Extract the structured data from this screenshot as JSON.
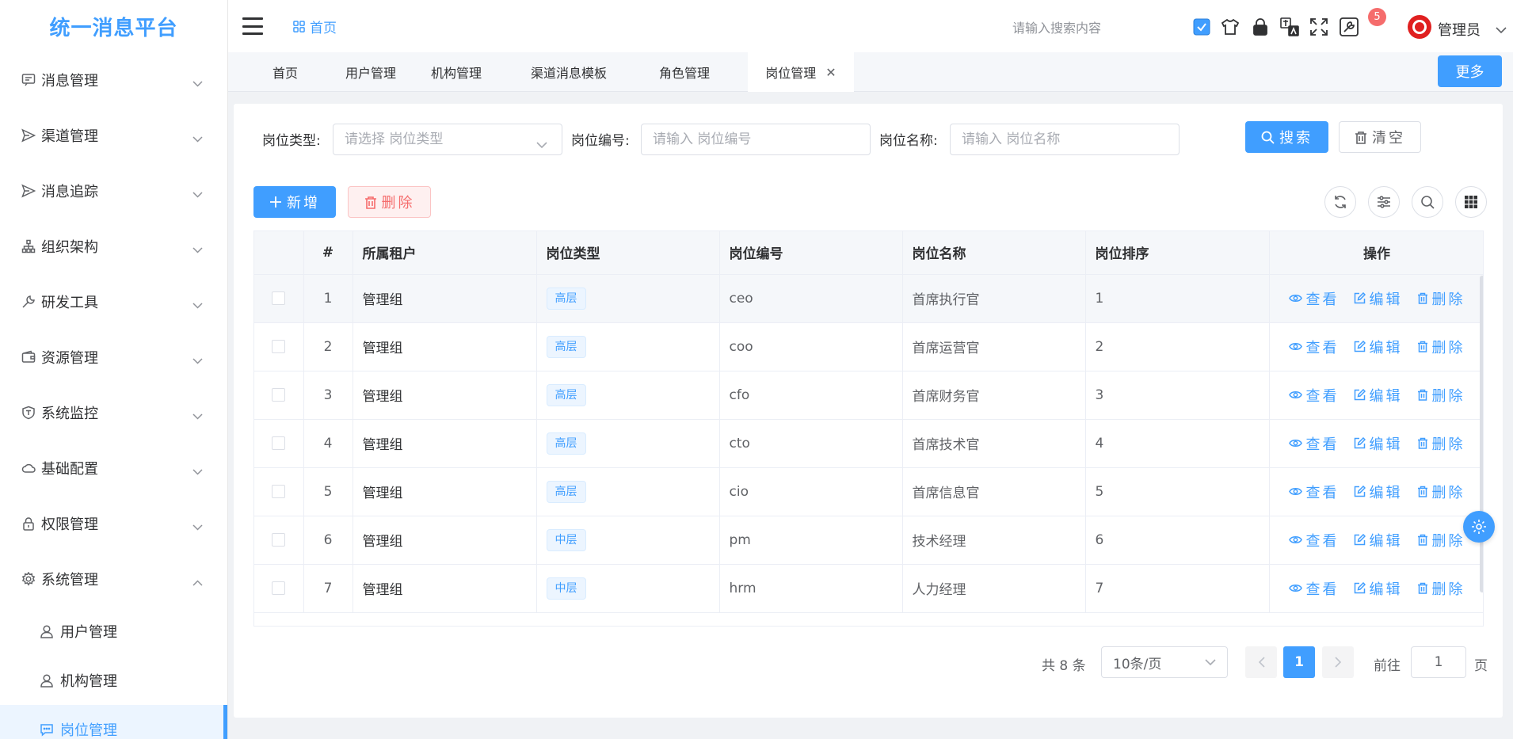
{
  "app": {
    "title": "统一消息平台"
  },
  "sidebar": {
    "items": [
      {
        "label": "消息管理",
        "icon": "message-icon",
        "expanded": false
      },
      {
        "label": "渠道管理",
        "icon": "send-icon",
        "expanded": false
      },
      {
        "label": "消息追踪",
        "icon": "send-icon",
        "expanded": false
      },
      {
        "label": "组织架构",
        "icon": "org-chart-icon",
        "expanded": false
      },
      {
        "label": "研发工具",
        "icon": "wrench-icon",
        "expanded": false
      },
      {
        "label": "资源管理",
        "icon": "wallet-icon",
        "expanded": false
      },
      {
        "label": "系统监控",
        "icon": "shield-icon",
        "expanded": false
      },
      {
        "label": "基础配置",
        "icon": "cloud-icon",
        "expanded": false
      },
      {
        "label": "权限管理",
        "icon": "lock-icon",
        "expanded": false
      },
      {
        "label": "系统管理",
        "icon": "gear-icon",
        "expanded": true
      }
    ],
    "sub_items": [
      {
        "label": "用户管理",
        "icon": "user-icon",
        "active": false
      },
      {
        "label": "机构管理",
        "icon": "user-icon",
        "active": false
      },
      {
        "label": "岗位管理",
        "icon": "chat-icon",
        "active": true
      }
    ]
  },
  "header": {
    "breadcrumb": "首页",
    "search_placeholder": "请输入搜索内容",
    "notification_count": "5",
    "user_name": "管理员"
  },
  "tabs": {
    "items": [
      {
        "label": "首页",
        "active": false
      },
      {
        "label": "用户管理",
        "active": false
      },
      {
        "label": "机构管理",
        "active": false
      },
      {
        "label": "渠道消息模板",
        "active": false
      },
      {
        "label": "角色管理",
        "active": false
      },
      {
        "label": "岗位管理",
        "active": true,
        "closable": true
      }
    ],
    "more_label": "更多"
  },
  "filters": {
    "type_label": "岗位类型:",
    "type_placeholder": "请选择 岗位类型",
    "code_label": "岗位编号:",
    "code_placeholder": "请输入 岗位编号",
    "name_label": "岗位名称:",
    "name_placeholder": "请输入 岗位名称",
    "search_label": "搜索",
    "clear_label": "清空"
  },
  "toolbar": {
    "add_label": "新增",
    "delete_label": "删除"
  },
  "table": {
    "columns": [
      "#",
      "所属租户",
      "岗位类型",
      "岗位编号",
      "岗位名称",
      "岗位排序",
      "操作"
    ],
    "rows": [
      {
        "index": "1",
        "tenant": "管理组",
        "type": "高层",
        "code": "ceo",
        "name": "首席执行官",
        "sort": "1"
      },
      {
        "index": "2",
        "tenant": "管理组",
        "type": "高层",
        "code": "coo",
        "name": "首席运营官",
        "sort": "2"
      },
      {
        "index": "3",
        "tenant": "管理组",
        "type": "高层",
        "code": "cfo",
        "name": "首席财务官",
        "sort": "3"
      },
      {
        "index": "4",
        "tenant": "管理组",
        "type": "高层",
        "code": "cto",
        "name": "首席技术官",
        "sort": "4"
      },
      {
        "index": "5",
        "tenant": "管理组",
        "type": "高层",
        "code": "cio",
        "name": "首席信息官",
        "sort": "5"
      },
      {
        "index": "6",
        "tenant": "管理组",
        "type": "中层",
        "code": "pm",
        "name": "技术经理",
        "sort": "6"
      },
      {
        "index": "7",
        "tenant": "管理组",
        "type": "中层",
        "code": "hrm",
        "name": "人力经理",
        "sort": "7"
      }
    ],
    "actions": {
      "view": "查看",
      "edit": "编辑",
      "delete": "删除"
    }
  },
  "pagination": {
    "total_text": "共 8 条",
    "page_size": "10条/页",
    "current_page": "1",
    "goto_label": "前往",
    "goto_value": "1",
    "page_label": "页"
  },
  "colors": {
    "primary": "#409eff",
    "danger": "#f56c6c",
    "sidebar_active_bg": "#ecf5ff"
  }
}
